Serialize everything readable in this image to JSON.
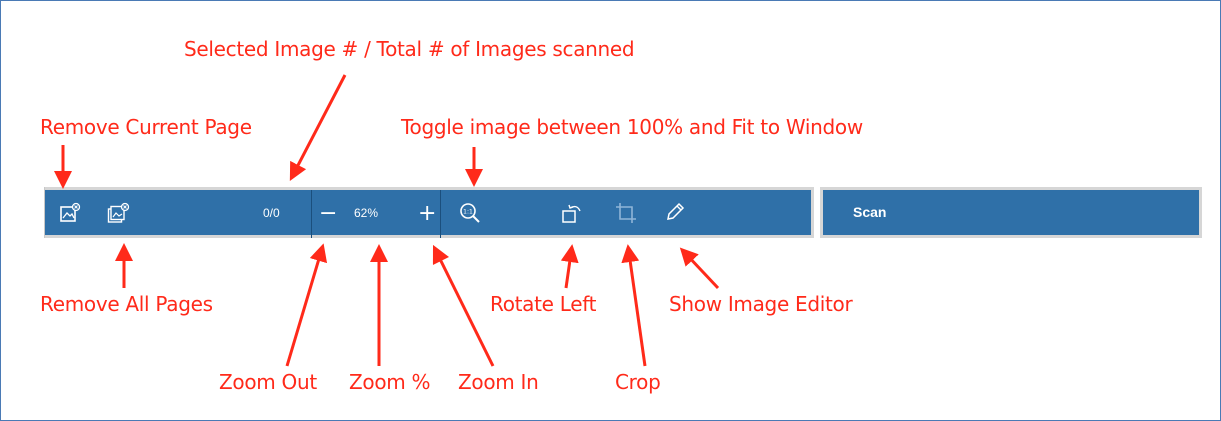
{
  "toolbar": {
    "page_counter": "0/0",
    "zoom_out_symbol": "−",
    "zoom_value": "62%",
    "zoom_in_symbol": "+",
    "icons": [
      "remove-current-page-icon",
      "remove-all-pages-icon",
      "toggle-fit-icon",
      "rotate-left-icon",
      "crop-icon",
      "show-image-editor-icon"
    ]
  },
  "scan_panel": {
    "label": "Scan"
  },
  "annotations": {
    "selected_image": "Selected Image # / Total # of Images scanned",
    "remove_current_page": "Remove Current Page",
    "toggle_image": "Toggle image between 100% and Fit to Window",
    "remove_all_pages": "Remove All Pages",
    "rotate_left": "Rotate Left",
    "show_image_editor": "Show Image Editor",
    "zoom_out": "Zoom Out",
    "zoom_percent": "Zoom %",
    "zoom_in": "Zoom In",
    "crop": "Crop"
  },
  "colors": {
    "toolbar_bg": "#2f70a8",
    "annotation": "#ff2a1a",
    "frame_border": "#4a7ab5"
  }
}
